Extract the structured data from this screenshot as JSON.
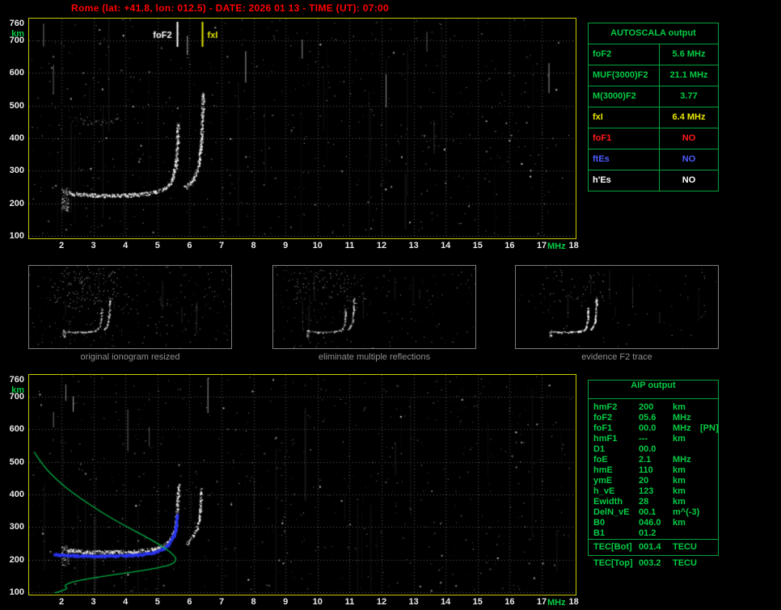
{
  "header": {
    "title": "Rome (lat: +41.8, lon: 012.5) - DATE: 2026 01 13 - TIME (UT): 07:00"
  },
  "colors": {
    "red": "#ff0000",
    "green": "#00cc44",
    "tick": "#e8e8e8",
    "plot_border": "#c9c900",
    "table_border": "#00a33c",
    "yellow": "#e6e600",
    "row_red": "#ff1a1a",
    "row_blue": "#4b5bff",
    "white": "#ffffff",
    "caption": "#8f8f8f",
    "grid": "#585858",
    "trace": "#ffffff",
    "profile": "#00b044",
    "restored": "#2b35f0"
  },
  "autoscala_table": {
    "header": "AUTOSCALA output",
    "rows": [
      {
        "label": "foF2",
        "value": "5.6 MHz",
        "color_key": "green"
      },
      {
        "label": "MUF(3000)F2",
        "value": "21.1 MHz",
        "color_key": "green"
      },
      {
        "label": "M(3000)F2",
        "value": "3.77",
        "color_key": "green"
      },
      {
        "label": "fxI",
        "value": "6.4 MHz",
        "color_key": "yellow"
      },
      {
        "label": "foF1",
        "value": "NO",
        "color_key": "red"
      },
      {
        "label": "ftEs",
        "value": "NO",
        "color_key": "blue"
      },
      {
        "label": "h'Es",
        "value": "NO",
        "color_key": "white"
      }
    ]
  },
  "thumbnails": [
    {
      "caption": "original ionogram resized"
    },
    {
      "caption": "eliminate multiple reflections"
    },
    {
      "caption": "evidence F2 trace"
    }
  ],
  "aip_table": {
    "header": "AIP output",
    "rows": [
      {
        "label": "hmF2",
        "value": "200",
        "unit": "km",
        "note": ""
      },
      {
        "label": "foF2",
        "value": "05.6",
        "unit": "MHz",
        "note": ""
      },
      {
        "label": "foF1",
        "value": "00.0",
        "unit": "MHz",
        "note": "[PN]"
      },
      {
        "label": "hmF1",
        "value": "---",
        "unit": "km",
        "note": ""
      },
      {
        "label": "D1",
        "value": "00.0",
        "unit": "",
        "note": ""
      },
      {
        "label": "foE",
        "value": "2.1",
        "unit": "MHz",
        "note": ""
      },
      {
        "label": "hmE",
        "value": "110",
        "unit": "km",
        "note": ""
      },
      {
        "label": "ymE",
        "value": "20",
        "unit": "km",
        "note": ""
      },
      {
        "label": "h_vE",
        "value": "123",
        "unit": "km",
        "note": ""
      },
      {
        "label": "Ewidth",
        "value": "28",
        "unit": "km",
        "note": ""
      },
      {
        "label": "DelN_vE",
        "value": "00.1",
        "unit": "m^(-3)",
        "note": ""
      },
      {
        "label": "B0",
        "value": "046.0",
        "unit": "km",
        "note": ""
      },
      {
        "label": "B1",
        "value": "01.2",
        "unit": "",
        "note": ""
      }
    ],
    "tec_rows": [
      {
        "label": "TEC[Bot]",
        "value": "001.4",
        "unit": "TECU"
      },
      {
        "label": "TEC[Top]",
        "value": "003.2",
        "unit": "TECU"
      }
    ]
  },
  "chart_data": [
    {
      "type": "scatter",
      "name": "autoscaled ionogram",
      "title": "",
      "xlabel": "MHz",
      "ylabel": "km",
      "xlim": [
        1,
        18
      ],
      "ylim": [
        90,
        760
      ],
      "xticks": [
        2,
        3,
        4,
        5,
        6,
        7,
        8,
        9,
        10,
        11,
        12,
        13,
        14,
        15,
        16,
        17,
        18
      ],
      "yticks": [
        760,
        700,
        600,
        500,
        400,
        300,
        200,
        100
      ],
      "grid": true,
      "markers": [
        {
          "label": "foF2",
          "f": 5.6,
          "color": "#ffffff"
        },
        {
          "label": "fxI",
          "f": 6.4,
          "color": "#e6e600"
        }
      ],
      "series": [
        {
          "name": "F2 ordinary trace",
          "render": "dots",
          "color": "#ffffff",
          "density": 2.4,
          "jitter": [
            1.6,
            2.2
          ],
          "anchors": [
            [
              2.2,
              233
            ],
            [
              2.6,
              228
            ],
            [
              3.2,
              225
            ],
            [
              4.0,
              226
            ],
            [
              4.5,
              229
            ],
            [
              4.85,
              234
            ],
            [
              5.1,
              241
            ],
            [
              5.3,
              252
            ],
            [
              5.42,
              267
            ],
            [
              5.5,
              288
            ],
            [
              5.56,
              318
            ],
            [
              5.6,
              360
            ],
            [
              5.62,
              410
            ],
            [
              5.63,
              448
            ]
          ]
        },
        {
          "name": "F2 extraordinary trace",
          "render": "dots",
          "color": "#ffffff",
          "density": 2.2,
          "jitter": [
            1.5,
            2.2
          ],
          "anchors": [
            [
              5.85,
              250
            ],
            [
              6.0,
              262
            ],
            [
              6.12,
              278
            ],
            [
              6.22,
              300
            ],
            [
              6.3,
              335
            ],
            [
              6.35,
              385
            ],
            [
              6.38,
              440
            ],
            [
              6.4,
              505
            ],
            [
              6.41,
              540
            ]
          ]
        },
        {
          "name": "multiple reflection echo",
          "render": "dots",
          "color": "#d0d0d0",
          "alpha": 0.5,
          "density": 0.5,
          "jitter": [
            2.2,
            3.0
          ],
          "anchors": [
            [
              2.3,
              462
            ],
            [
              2.7,
              452
            ],
            [
              3.1,
              449
            ],
            [
              3.5,
              452
            ],
            [
              3.9,
              460
            ]
          ]
        },
        {
          "name": "E region cusp",
          "render": "cluster",
          "color": "#ffffff",
          "count": 85,
          "f": [
            2.0,
            2.22
          ],
          "h": [
            176,
            248
          ]
        }
      ]
    },
    {
      "type": "scatter",
      "name": "restored ionogram with electron density profile",
      "title": "",
      "xlabel": "MHz",
      "ylabel": "km",
      "xlim": [
        1,
        18
      ],
      "ylim": [
        90,
        760
      ],
      "xticks": [
        2,
        3,
        4,
        5,
        6,
        7,
        8,
        9,
        10,
        11,
        12,
        13,
        14,
        15,
        16,
        17,
        18
      ],
      "yticks": [
        760,
        700,
        600,
        500,
        400,
        300,
        200,
        100
      ],
      "grid": true,
      "markers": [],
      "series": [
        {
          "name": "F2 ordinary trace",
          "render": "dots",
          "color": "#ffffff",
          "density": 2.3,
          "jitter": [
            1.6,
            2.2
          ],
          "anchors": [
            [
              2.2,
              230
            ],
            [
              2.6,
              226
            ],
            [
              3.2,
              224
            ],
            [
              4.0,
              225
            ],
            [
              4.5,
              228
            ],
            [
              4.85,
              233
            ],
            [
              5.1,
              240
            ],
            [
              5.3,
              252
            ],
            [
              5.45,
              270
            ],
            [
              5.55,
              300
            ],
            [
              5.6,
              345
            ],
            [
              5.63,
              400
            ],
            [
              5.65,
              432
            ]
          ]
        },
        {
          "name": "F2 extraordinary trace",
          "render": "dots",
          "color": "#ffffff",
          "density": 1.6,
          "jitter": [
            1.5,
            2.2
          ],
          "anchors": [
            [
              5.9,
              250
            ],
            [
              6.05,
              265
            ],
            [
              6.2,
              290
            ],
            [
              6.3,
              330
            ],
            [
              6.35,
              380
            ],
            [
              6.37,
              420
            ]
          ]
        },
        {
          "name": "E region cusp",
          "render": "cluster",
          "color": "#ffffff",
          "count": 70,
          "f": [
            2.0,
            2.22
          ],
          "h": [
            180,
            245
          ]
        },
        {
          "name": "restored trace",
          "render": "dots",
          "color": "#2b35f0",
          "density": 2.5,
          "jitter": [
            1.2,
            1.2
          ],
          "size": 2,
          "alpha": 0.95,
          "anchors": [
            [
              1.75,
              218
            ],
            [
              2.1,
              216
            ],
            [
              2.6,
              214
            ],
            [
              3.2,
              213
            ],
            [
              4.0,
              215
            ],
            [
              4.5,
              218
            ],
            [
              4.8,
              223
            ],
            [
              5.05,
              230
            ],
            [
              5.25,
              242
            ],
            [
              5.4,
              258
            ],
            [
              5.5,
              280
            ],
            [
              5.56,
              308
            ],
            [
              5.6,
              340
            ]
          ]
        },
        {
          "name": "electron density profile",
          "render": "line",
          "color": "#00b044",
          "width": 1.3,
          "anchors": [
            [
              1.15,
              530
            ],
            [
              1.4,
              492
            ],
            [
              1.75,
              455
            ],
            [
              2.15,
              420
            ],
            [
              2.6,
              388
            ],
            [
              3.1,
              355
            ],
            [
              3.6,
              325
            ],
            [
              4.1,
              298
            ],
            [
              4.6,
              272
            ],
            [
              5.0,
              250
            ],
            [
              5.3,
              231
            ],
            [
              5.5,
              215
            ],
            [
              5.6,
              200
            ],
            [
              5.45,
              185
            ],
            [
              5.0,
              174
            ],
            [
              4.3,
              163
            ],
            [
              3.5,
              152
            ],
            [
              2.85,
              142
            ],
            [
              2.4,
              133
            ],
            [
              2.15,
              125
            ],
            [
              2.1,
              118
            ],
            [
              2.2,
              112
            ],
            [
              2.05,
              106
            ],
            [
              1.9,
              101
            ],
            [
              1.75,
              97
            ],
            [
              1.8,
              93
            ],
            [
              1.7,
              90
            ]
          ]
        }
      ]
    }
  ]
}
